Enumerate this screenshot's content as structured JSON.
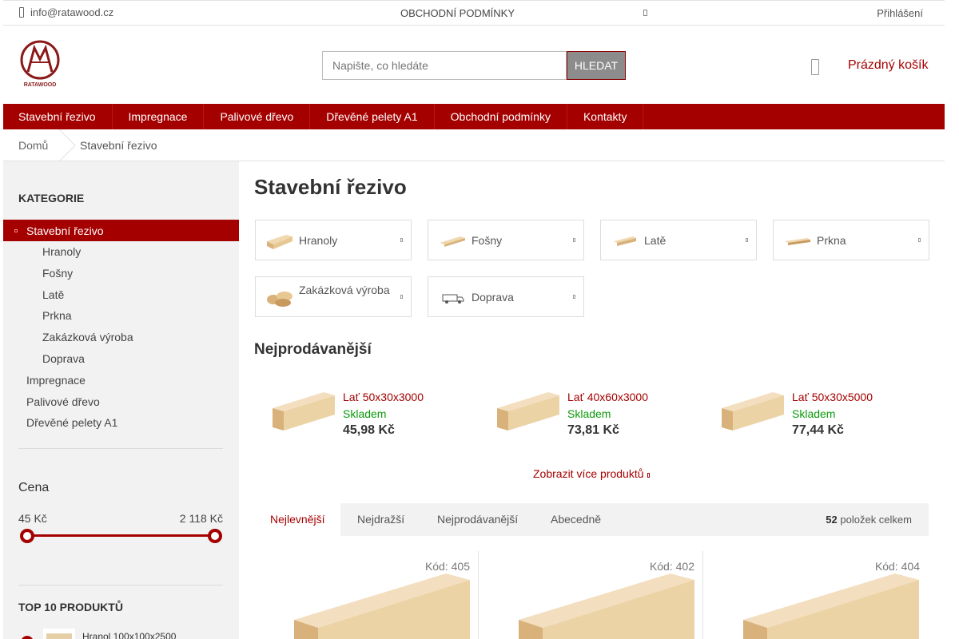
{
  "topbar": {
    "email": "info@ratawood.cz",
    "terms": "OBCHODNÍ PODMÍNKY",
    "login": "Přihlášení"
  },
  "header": {
    "logo_text": "RATAWOOD",
    "search_placeholder": "Napište, co hledáte",
    "search_button": "HLEDAT",
    "cart_label": "Prázdný košík"
  },
  "nav": {
    "items": [
      "Stavební řezivo",
      "Impregnace",
      "Palivové dřevo",
      "Dřevěné pelety A1",
      "Obchodní podmínky",
      "Kontakty"
    ]
  },
  "breadcrumb": {
    "home": "Domů",
    "current": "Stavební řezivo"
  },
  "sidebar": {
    "title": "KATEGORIE",
    "active": "Stavební řezivo",
    "sub": [
      "Hranoly",
      "Fošny",
      "Latě",
      "Prkna",
      "Zakázková výroba",
      "Doprava"
    ],
    "top": [
      "Impregnace",
      "Palivové dřevo",
      "Dřevěné pelety A1"
    ],
    "price_title": "Cena",
    "price_min": "45 Kč",
    "price_max": "2 118 Kč",
    "top10_title": "TOP 10 PRODUKTŮ",
    "top10_first": "Hranol 100x100x2500"
  },
  "main": {
    "title": "Stavební řezivo",
    "subcats": [
      "Hranoly",
      "Fošny",
      "Latě",
      "Prkna",
      "Zakázková výroba",
      "Doprava"
    ],
    "best_title": "Nejprodávanější",
    "best": [
      {
        "name": "Lať 50x30x3000",
        "stock": "Skladem",
        "price": "45,98 Kč"
      },
      {
        "name": "Lať 40x60x3000",
        "stock": "Skladem",
        "price": "73,81 Kč"
      },
      {
        "name": "Lať 50x30x5000",
        "stock": "Skladem",
        "price": "77,44 Kč"
      }
    ],
    "more": "Zobrazit více produktů",
    "sort_tabs": [
      "Nejlevnější",
      "Nejdražší",
      "Nejprodávanější",
      "Abecedně"
    ],
    "count_num": "52",
    "count_text": "položek celkem",
    "products": [
      {
        "code": "Kód: 405"
      },
      {
        "code": "Kód: 402"
      },
      {
        "code": "Kód: 404"
      }
    ]
  },
  "colors": {
    "brand": "#a50000",
    "stock": "#0a9a0a",
    "sidebar_bg": "#f2f2f2"
  }
}
